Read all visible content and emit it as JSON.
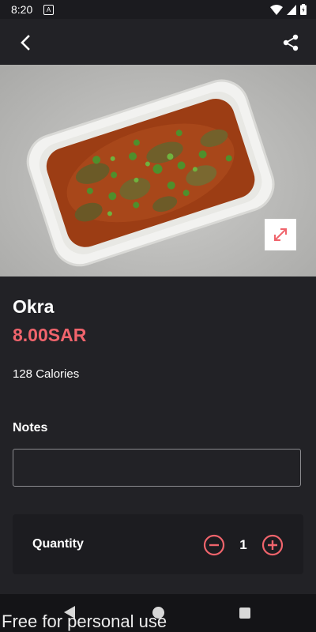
{
  "status_bar": {
    "time": "8:20",
    "badge": "A"
  },
  "app_bar": {
    "back_icon": "chevron-left-icon",
    "share_icon": "share-icon"
  },
  "hero": {
    "expand_icon": "expand-arrows-icon"
  },
  "product": {
    "name": "Okra",
    "price": "8.00SAR",
    "calories": "128 Calories"
  },
  "notes": {
    "label": "Notes",
    "value": "",
    "placeholder": ""
  },
  "quantity": {
    "label": "Quantity",
    "value": "1"
  },
  "watermark": "Free for personal use",
  "colors": {
    "accent": "#f0646c",
    "background": "#222226",
    "card": "#1c1c20"
  }
}
